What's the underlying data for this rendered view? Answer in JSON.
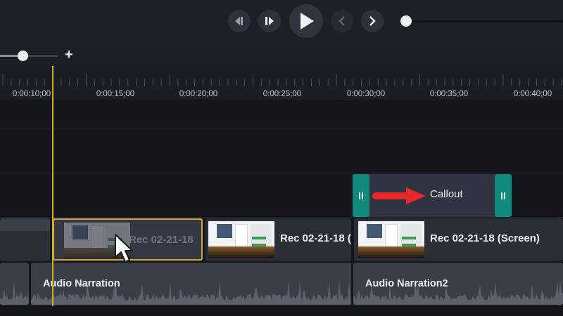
{
  "transport": {
    "prev_icon": "skip-back-icon",
    "step_forward_icon": "step-forward-icon",
    "play_icon": "play-icon",
    "back_icon": "chevron-left-icon",
    "next_icon": "chevron-right-icon"
  },
  "zoom": {
    "plus_label": "+"
  },
  "ruler": {
    "timecodes": [
      "0:00:10;00",
      "0:00:15;00",
      "0:00:20;00",
      "0:00:25;00",
      "0:00:30;00",
      "0:00:35;00",
      "0:00:40;00"
    ]
  },
  "tracks": {
    "callout": {
      "label": "Callout",
      "arrow_color": "#e8282b",
      "handle_color": "#0f8a7c"
    },
    "video_clips": [
      {
        "label": ""
      },
      {
        "label": "Rec 02-21-18"
      },
      {
        "label": "Rec 02-21-18 ("
      },
      {
        "label": "Rec 02-21-18 (Screen)"
      }
    ],
    "audio_clips": [
      {
        "label": ""
      },
      {
        "label": "Audio Narration"
      },
      {
        "label": "Audio Narration2"
      }
    ]
  },
  "colors": {
    "playhead": "#d8b020",
    "selection_border": "#d7a336",
    "accent_teal": "#0f8a7c"
  }
}
